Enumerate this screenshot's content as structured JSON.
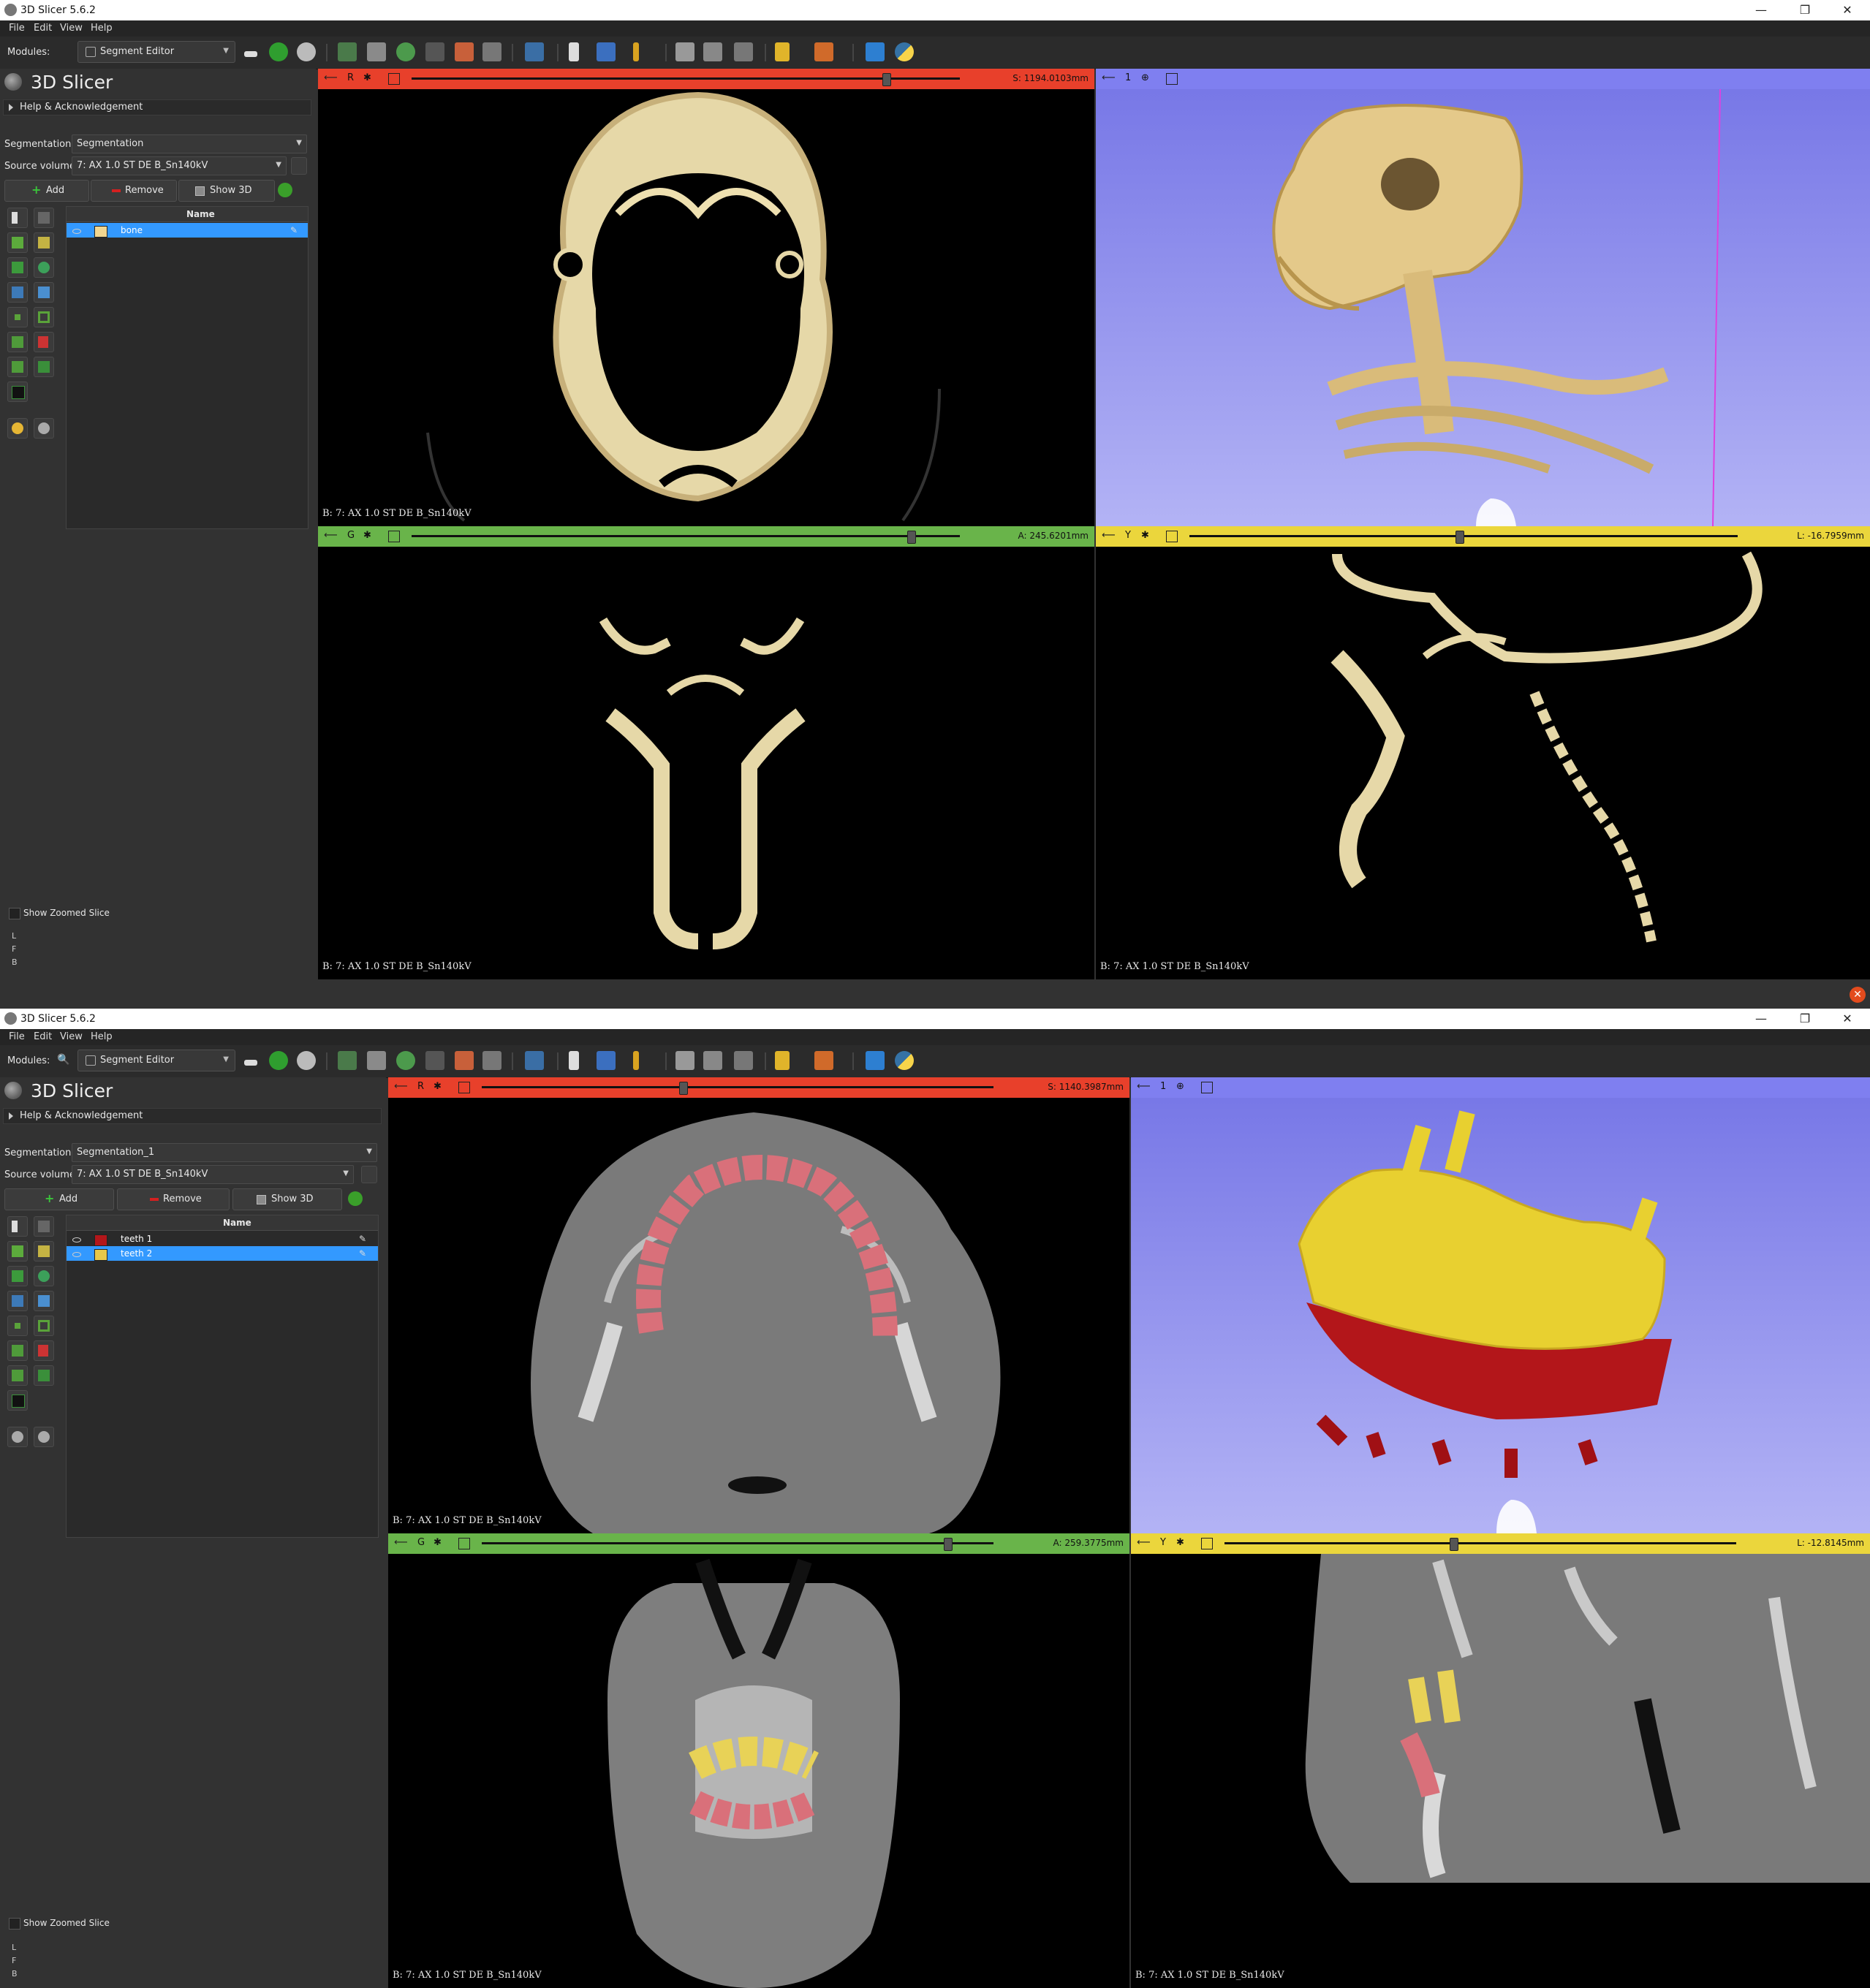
{
  "app": {
    "title": "3D Slicer 5.6.2",
    "logo_text": "3D Slicer",
    "menus": [
      "File",
      "Edit",
      "View",
      "Help"
    ],
    "modules_label": "Modules:",
    "module_selected": "Segment Editor",
    "help_section": "Help & Acknowledgement",
    "segmentation_label": "Segmentation:",
    "source_volume_label": "Source volume:",
    "add_label": "Add",
    "remove_label": "Remove",
    "show3d_label": "Show 3D",
    "name_column": "Name",
    "show_zoomed_slice": "Show Zoomed Slice",
    "orientation_letters": [
      "L",
      "F",
      "B"
    ],
    "window_controls": [
      "—",
      "❐",
      "✕"
    ]
  },
  "windows": [
    {
      "segmentation": "Segmentation",
      "source_volume": "7: AX 1.0 ST DE  B_Sn140kV",
      "segments": [
        {
          "name": "bone",
          "color": "#f1d691",
          "selected": true
        }
      ],
      "views": {
        "red": {
          "letter": "R",
          "value": "S: 1194.0103mm",
          "label": "B: 7: AX 1.0 ST DE  B_Sn140kV"
        },
        "threed": {
          "letter": "1"
        },
        "green": {
          "letter": "G",
          "value": "A: 245.6201mm",
          "label": "B: 7: AX 1.0 ST DE  B_Sn140kV"
        },
        "yellow": {
          "letter": "Y",
          "value": "L: -16.7959mm",
          "label": "B: 7: AX 1.0 ST DE  B_Sn140kV"
        }
      }
    },
    {
      "segmentation": "Segmentation_1",
      "source_volume": "7: AX 1.0 ST DE  B_Sn140kV",
      "segments": [
        {
          "name": "teeth 1",
          "color": "#b3161a",
          "selected": false
        },
        {
          "name": "teeth 2",
          "color": "#e6c84a",
          "selected": true
        }
      ],
      "views": {
        "red": {
          "letter": "R",
          "value": "S: 1140.3987mm",
          "label": "B: 7: AX 1.0 ST DE  B_Sn140kV"
        },
        "threed": {
          "letter": "1"
        },
        "green": {
          "letter": "G",
          "value": "A: 259.3775mm",
          "label": "B: 7: AX 1.0 ST DE  B_Sn140kV"
        },
        "yellow": {
          "letter": "Y",
          "value": "L: -12.8145mm",
          "label": "B: 7: AX 1.0 ST DE  B_Sn140kV"
        }
      }
    }
  ],
  "colors": {
    "red_view": "#e8402b",
    "green_view": "#69b44a",
    "yellow_view": "#ebd63c",
    "threed_view": "#7f7ff0",
    "bone": "#f1d691",
    "teeth_red": "#b3161a",
    "teeth_yellow": "#e6c84a",
    "selection": "#3399ff"
  }
}
